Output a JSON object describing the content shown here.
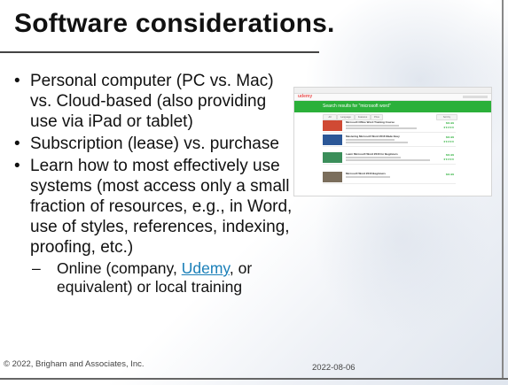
{
  "slide": {
    "title": "Software considerations.",
    "bullets": [
      {
        "marker": "•",
        "text": "Personal computer (PC vs. Mac) vs. Cloud-based (also providing use via iPad or tablet)"
      },
      {
        "marker": "•",
        "text": "Subscription (lease) vs. purchase"
      },
      {
        "marker": "•",
        "text": "Learn how to most effectively use systems (most access only a small fraction of resources, e.g., in Word, use of styles, references, indexing, proofing, etc.)"
      }
    ],
    "sub_bullet": {
      "marker": "–",
      "text_before": "Online (company, ",
      "link": "Udemy",
      "text_after": ", or equivalent) or local training"
    },
    "footer_left": "© 2022, Brigham and Associates, Inc.",
    "footer_date": "2022-08-06"
  },
  "screenshot": {
    "logo": "udemy",
    "banner_text": "Search results for \"microsoft word\"",
    "filters": [
      "All",
      "Language",
      "Features",
      "Price"
    ],
    "filter_right": "Sort by",
    "results": [
      {
        "title": "Microsoft Office Word Training Course",
        "price": "$11.99",
        "thumb_color": "#d04a34"
      },
      {
        "title": "Mastering Microsoft Word 2016 Made Easy",
        "price": "$11.99",
        "thumb_color": "#2b5797"
      },
      {
        "title": "Learn Microsoft Word 2016 for Beginners",
        "price": "$11.99",
        "thumb_color": "#3b8e5a"
      },
      {
        "title": "Microsoft Word 2016 Beginners",
        "price": "$11.99",
        "thumb_color": "#7b6e5c"
      }
    ],
    "stars": "★★★★★"
  }
}
